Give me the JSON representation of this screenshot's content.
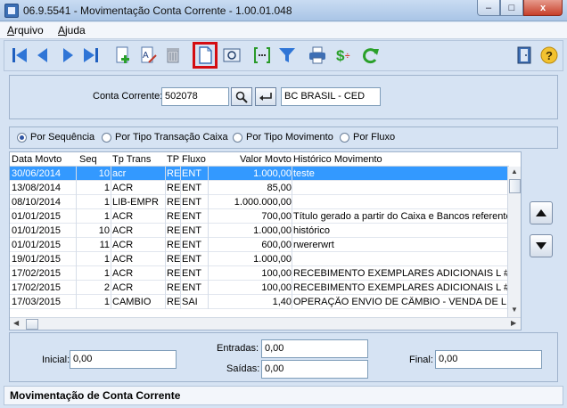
{
  "window": {
    "title": "06.9.5541 - Movimentação Conta Corrente - 1.00.01.048",
    "min_label": "–",
    "max_label": "□",
    "close_label": "x"
  },
  "menu": {
    "arquivo_first": "A",
    "arquivo_rest": "rquivo",
    "ajuda_first": "A",
    "ajuda_rest": "juda"
  },
  "toolbar": {
    "icons": [
      "first-record-icon",
      "previous-record-icon",
      "next-record-icon",
      "last-record-icon",
      "new-record-icon",
      "edit-record-icon",
      "delete-record-icon",
      "blank-page-icon",
      "preview-icon",
      "bracket-field-icon",
      "filter-icon",
      "print-icon",
      "currency-icon",
      "refresh-icon",
      "exit-door-icon",
      "help-icon"
    ],
    "highlight_color": "#d40d12"
  },
  "account": {
    "label": "Conta Corrente:",
    "code": "502078",
    "bank": "BC BRASIL - CED"
  },
  "view_options": [
    {
      "label": "Por Sequência",
      "selected": true
    },
    {
      "label": "Por Tipo Transação Caixa",
      "selected": false
    },
    {
      "label": "Por Tipo Movimento",
      "selected": false
    },
    {
      "label": "Por Fluxo",
      "selected": false
    }
  ],
  "grid": {
    "headers": [
      "Data Movto",
      "Seq",
      "Tp Trans",
      "TP",
      "Fluxo",
      "Valor Movto",
      "Histórico Movimento"
    ],
    "rows": [
      [
        "30/06/2014",
        "10",
        "acr",
        "RE",
        "ENT",
        "1.000,00",
        "teste"
      ],
      [
        "13/08/2014",
        "1",
        "ACR",
        "RE",
        "ENT",
        "85,00",
        ""
      ],
      [
        "08/10/2014",
        "1",
        "LIB-EMPR",
        "RE",
        "ENT",
        "1.000.000,00",
        ""
      ],
      [
        "01/01/2015",
        "1",
        "ACR",
        "RE",
        "ENT",
        "700,00",
        "Título gerado a partir do Caixa e Bancos referente"
      ],
      [
        "01/01/2015",
        "10",
        "ACR",
        "RE",
        "ENT",
        "1.000,00",
        "histórico"
      ],
      [
        "01/01/2015",
        "11",
        "ACR",
        "RE",
        "ENT",
        "600,00",
        "rwererwrt"
      ],
      [
        "19/01/2015",
        "1",
        "ACR",
        "RE",
        "ENT",
        "1.000,00",
        ""
      ],
      [
        "17/02/2015",
        "1",
        "ACR",
        "RE",
        "ENT",
        "100,00",
        "RECEBIMENTO EXEMPLARES ADICIONAIS L #N"
      ],
      [
        "17/02/2015",
        "2",
        "ACR",
        "RE",
        "ENT",
        "100,00",
        "RECEBIMENTO EXEMPLARES ADICIONAIS L #N"
      ],
      [
        "17/03/2015",
        "1",
        "CAMBIO",
        "RE",
        "SAI",
        "1,40",
        "OPERAÇÃO ENVIO DE CÂMBIO - VENDA DE LIV"
      ]
    ],
    "selected_row": 0,
    "selection_color": "#3399ff"
  },
  "totals": {
    "inicial_label": "Inicial:",
    "inicial_value": "0,00",
    "entradas_label": "Entradas:",
    "entradas_value": "0,00",
    "saidas_label": "Saídas:",
    "saidas_value": "0,00",
    "final_label": "Final:",
    "final_value": "0,00"
  },
  "status": {
    "text": "Movimentação de Conta Corrente"
  }
}
